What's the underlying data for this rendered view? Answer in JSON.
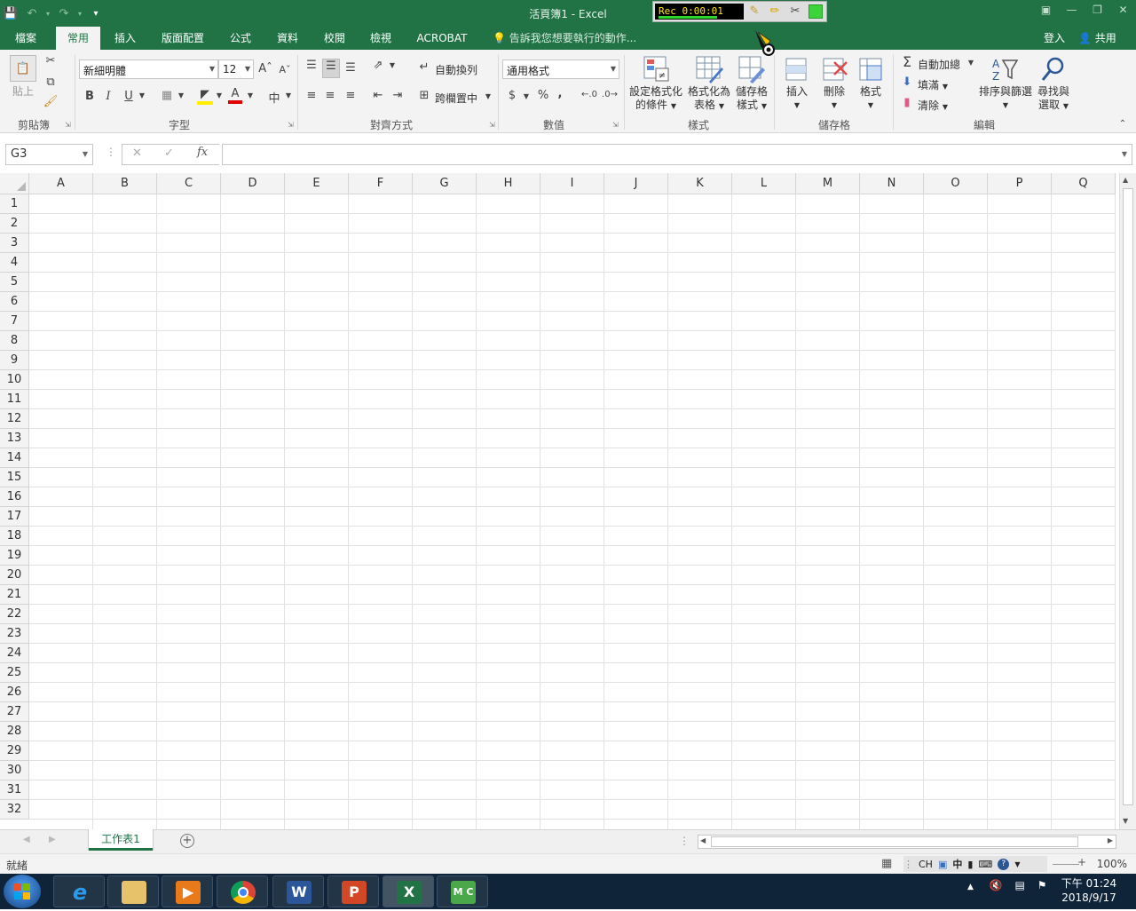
{
  "window": {
    "title": "活頁簿1 - Excel",
    "recorder": {
      "time": "Rec 0:00:01"
    }
  },
  "tabs": [
    {
      "label": "檔案"
    },
    {
      "label": "常用"
    },
    {
      "label": "插入"
    },
    {
      "label": "版面配置"
    },
    {
      "label": "公式"
    },
    {
      "label": "資料"
    },
    {
      "label": "校閱"
    },
    {
      "label": "檢視"
    },
    {
      "label": "ACROBAT"
    }
  ],
  "tell_me": "告訴我您想要執行的動作...",
  "login": "登入",
  "share": "共用",
  "ribbon": {
    "clipboard": {
      "paste": "貼上",
      "label": "剪貼簿"
    },
    "font": {
      "name": "新細明體",
      "size": "12",
      "bold": "B",
      "italic": "I",
      "underline": "U",
      "label": "字型"
    },
    "alignment": {
      "wrap": "自動換列",
      "merge": "跨欄置中",
      "label": "對齊方式"
    },
    "number": {
      "format": "通用格式",
      "currency": "$",
      "percent": "%",
      "comma": ",",
      "label": "數值"
    },
    "styles": {
      "conditional": [
        "設定格式化",
        "的條件"
      ],
      "table": [
        "格式化為",
        "表格"
      ],
      "cell": [
        "儲存格",
        "樣式"
      ],
      "label": "樣式"
    },
    "cells": {
      "insert": "插入",
      "delete": "刪除",
      "format": "格式",
      "label": "儲存格"
    },
    "editing": {
      "autosum": "自動加總",
      "fill": "填滿",
      "clear": "清除",
      "sort": "排序與篩選",
      "find": [
        "尋找與",
        "選取"
      ],
      "label": "編輯"
    }
  },
  "formula_bar": {
    "name_box": "G3",
    "fx": "fx",
    "value": ""
  },
  "grid": {
    "columns": [
      "A",
      "B",
      "C",
      "D",
      "E",
      "F",
      "G",
      "H",
      "I",
      "J",
      "K",
      "L",
      "M",
      "N",
      "O",
      "P",
      "Q"
    ],
    "rows": [
      "1",
      "2",
      "3",
      "4",
      "5",
      "6",
      "7",
      "8",
      "9",
      "10",
      "11",
      "12",
      "13",
      "14",
      "15",
      "16",
      "17",
      "18",
      "19",
      "20",
      "21",
      "22",
      "23",
      "24",
      "25",
      "26",
      "27",
      "28",
      "29",
      "30",
      "31",
      "32"
    ]
  },
  "sheets": [
    {
      "name": "工作表1"
    }
  ],
  "status": {
    "ready": "就緒",
    "zoom": "100%",
    "ime_lang": "CH",
    "ime_mode": "中"
  },
  "taskbar": {
    "apps": [
      "ie",
      "explorer",
      "media-player",
      "chrome",
      "word",
      "powerpoint",
      "excel",
      "camtasia"
    ],
    "clock_time": "下午 01:24",
    "clock_date": "2018/9/17"
  },
  "colors": {
    "excel_green": "#217346",
    "taskbar": "#0f2438"
  }
}
